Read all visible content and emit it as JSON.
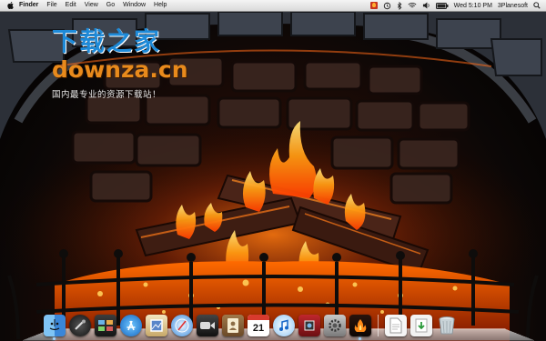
{
  "menubar": {
    "app_name": "Finder",
    "menus": [
      "File",
      "Edit",
      "View",
      "Go",
      "Window",
      "Help"
    ],
    "clock": "Wed 5:10 PM",
    "user": "3Planesoft"
  },
  "watermark": {
    "title": "下载之家",
    "url": "downza.cn",
    "tagline": "国内最专业的资源下载站！"
  },
  "dock": {
    "items": [
      {
        "name": "finder",
        "icon": "finder-icon"
      },
      {
        "name": "dashboard",
        "icon": "dashboard-icon"
      },
      {
        "name": "mission-control",
        "icon": "mission-control-icon"
      },
      {
        "name": "app-store",
        "icon": "app-store-icon"
      },
      {
        "name": "preview",
        "icon": "preview-icon"
      },
      {
        "name": "safari",
        "icon": "safari-icon"
      },
      {
        "name": "facetime",
        "icon": "facetime-icon"
      },
      {
        "name": "address-book",
        "icon": "address-book-icon"
      },
      {
        "name": "calendar",
        "icon": "calendar-icon"
      },
      {
        "name": "itunes",
        "icon": "itunes-icon"
      },
      {
        "name": "photo-booth",
        "icon": "photo-booth-icon"
      },
      {
        "name": "system-preferences",
        "icon": "system-preferences-icon"
      },
      {
        "name": "fireplace-screensaver",
        "icon": "fireplace-icon"
      },
      {
        "name": "document",
        "icon": "document-icon"
      },
      {
        "name": "downloads",
        "icon": "downloads-icon"
      },
      {
        "name": "trash",
        "icon": "trash-icon"
      }
    ],
    "calendar_day": "21"
  },
  "colors": {
    "watermark_blue": "#1e8ad8",
    "watermark_orange": "#e88a1c",
    "fire": "#ff8a1a",
    "brick": "#3a2620"
  }
}
